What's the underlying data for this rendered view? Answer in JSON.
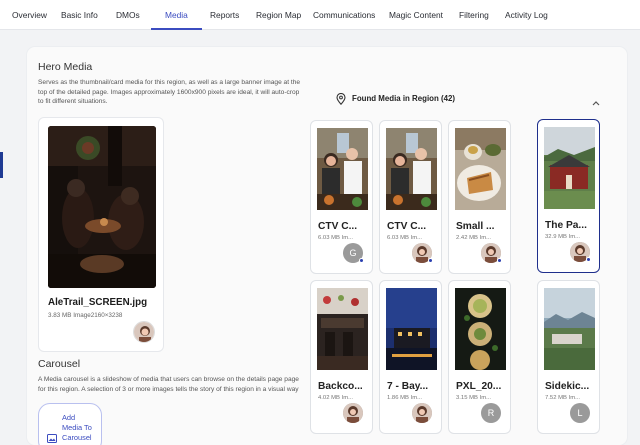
{
  "tabs": [
    "Overview",
    "Basic Info",
    "DMOs",
    "Media",
    "Reports",
    "Region Map",
    "Communications",
    "Magic Content",
    "Filtering",
    "Activity Log"
  ],
  "active_tab": "Media",
  "hero": {
    "title": "Hero Media",
    "description": "Serves as the thumbnail/card media for this region, as well as a large banner image at the top of the detailed page. Images approximately 1600x900 pixels are ideal, it will auto-crop to fit different situations.",
    "file_name": "AleTrail_SCREEN.jpg",
    "file_meta": "3.83 MB Image2160×3238"
  },
  "carousel": {
    "title": "Carousel",
    "description": "A Media carousel is a slideshow of media that users can browse on the details page page for this region. A selection of 3 or more images tells the story of this region in a visual way",
    "add_button": "Add Media To Carousel"
  },
  "found": {
    "header": "Found Media in Region (42)",
    "items": [
      {
        "title": "CTV C...",
        "meta": "6.03 MB Im...",
        "avatar": "G",
        "selected": false
      },
      {
        "title": "CTV C...",
        "meta": "6.03 MB Im...",
        "avatar": "",
        "selected": false
      },
      {
        "title": "Small ...",
        "meta": "2.42 MB Im...",
        "avatar": "",
        "selected": false
      },
      {
        "title": "The Pa...",
        "meta": "32.9 MB Im...",
        "avatar": "",
        "selected": true
      },
      {
        "title": "Backco...",
        "meta": "4.02 MB Im...",
        "avatar": "",
        "selected": false
      },
      {
        "title": "7 - Bay...",
        "meta": "1.86 MB Im...",
        "avatar": "",
        "selected": false
      },
      {
        "title": "PXL_20...",
        "meta": "3.15 MB Im...",
        "avatar": "R",
        "selected": false
      },
      {
        "title": "Sidekic...",
        "meta": "7.52 MB Im...",
        "avatar": "L",
        "selected": false
      }
    ]
  },
  "colors": {
    "accent": "#3b4cc0",
    "selected_border": "#1f2f8c"
  }
}
